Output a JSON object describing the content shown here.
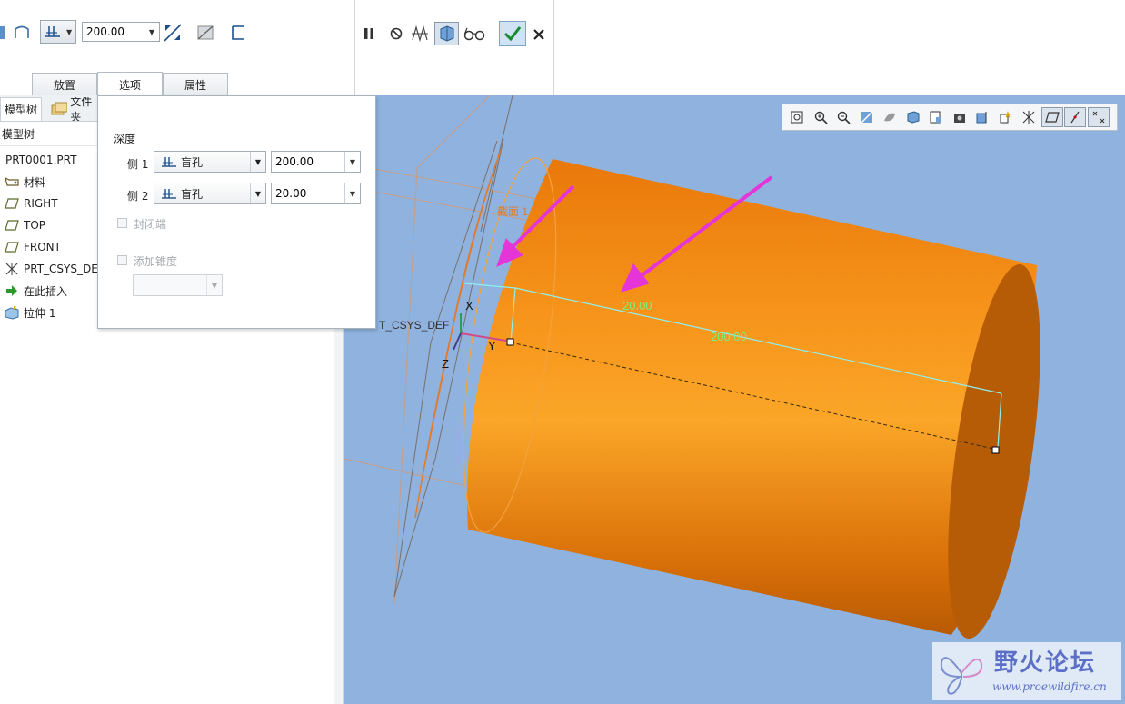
{
  "dashboard": {
    "depth_value": "200.00",
    "tabs": [
      {
        "label": "放置"
      },
      {
        "label": "选项"
      },
      {
        "label": "属性"
      }
    ],
    "icons": {
      "left": [
        "extrude-surface-icon",
        "blind-depth-icon",
        "flip-direction-icon",
        "remove-material-icon",
        "thicken-icon"
      ],
      "mid": [
        "pause-icon",
        "no-preview-icon",
        "geometry-preview-icon",
        "feature-preview-icon",
        "glasses-icon",
        "ok-check-icon",
        "cancel-x-icon"
      ]
    }
  },
  "left_panel": {
    "tabs": [
      {
        "label": "模型树"
      },
      {
        "label": "文件夹"
      }
    ],
    "tree_header": "模型树",
    "tree_items": [
      {
        "label": "PRT0001.PRT"
      },
      {
        "label": "材料"
      },
      {
        "label": "RIGHT"
      },
      {
        "label": "TOP"
      },
      {
        "label": "FRONT"
      },
      {
        "label": "PRT_CSYS_DEF"
      },
      {
        "label": "在此插入"
      },
      {
        "label": "拉伸 1"
      }
    ]
  },
  "options_panel": {
    "depth_title": "深度",
    "side1": {
      "label": "侧 1",
      "type": "盲孔",
      "value": "200.00"
    },
    "side2": {
      "label": "侧 2",
      "type": "盲孔",
      "value": "20.00"
    },
    "capped_ends": {
      "label": "封闭端",
      "checked": false,
      "disabled": true
    },
    "add_taper": {
      "label": "添加锥度",
      "checked": false,
      "disabled": true
    }
  },
  "graphics": {
    "background": "#8fb3de",
    "body_color": "#f08a10",
    "dim_side2": "20.00",
    "dim_side1": "200.00",
    "sketch_label": "截面 1",
    "csys_label": "T_CSYS_DEF",
    "axis_x": "X",
    "axis_y": "Y",
    "axis_z": "Z",
    "arrow_color": "#e535d8"
  },
  "watermark": {
    "title": "野火论坛",
    "url": "www.proewildfire.cn"
  }
}
